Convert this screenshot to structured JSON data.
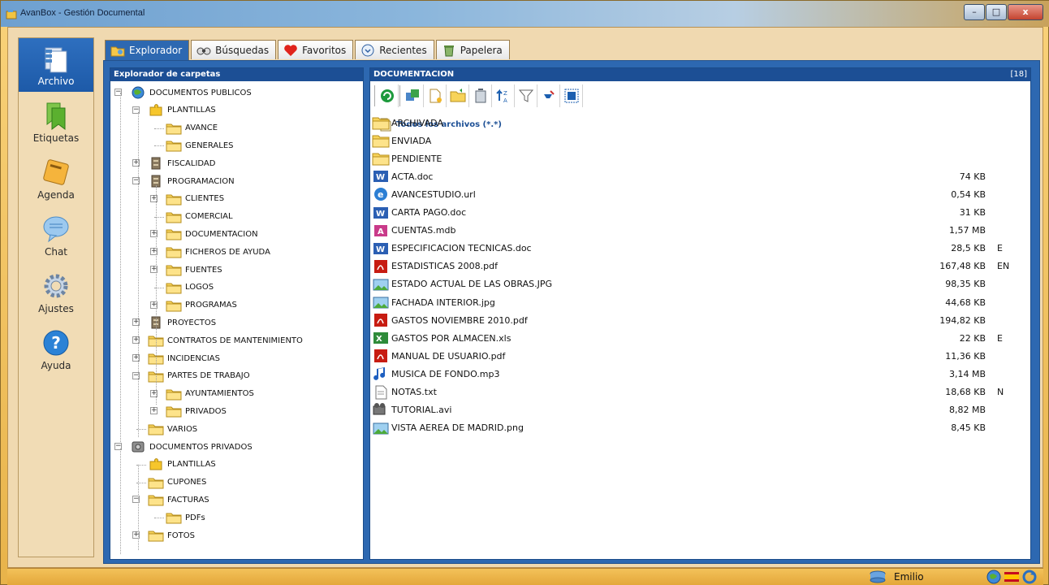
{
  "window": {
    "title": "AvanBox - Gestión Documental",
    "min": "–",
    "max": "□",
    "close": "x"
  },
  "nav": [
    {
      "label": "Archivo",
      "icon": "archive-icon"
    },
    {
      "label": "Etiquetas",
      "icon": "tag-icon"
    },
    {
      "label": "Agenda",
      "icon": "agenda-book-icon"
    },
    {
      "label": "Chat",
      "icon": "chat-bubble-icon"
    },
    {
      "label": "Ajustes",
      "icon": "gear-icon"
    },
    {
      "label": "Ayuda",
      "icon": "help-icon"
    }
  ],
  "tabs": [
    {
      "label": "Explorador",
      "icon": "explorer-folder-icon"
    },
    {
      "label": "Búsquedas",
      "icon": "binoculars-icon"
    },
    {
      "label": "Favoritos",
      "icon": "heart-icon"
    },
    {
      "label": "Recientes",
      "icon": "recent-clock-icon"
    },
    {
      "label": "Papelera",
      "icon": "trash-icon"
    }
  ],
  "tree_panel": {
    "title": "Explorador de carpetas"
  },
  "tree": [
    {
      "label": "DOCUMENTOS PUBLICOS",
      "level": 0,
      "exp": "−",
      "icon": "globe"
    },
    {
      "label": "PLANTILLAS",
      "level": 1,
      "exp": "−",
      "icon": "puzzle"
    },
    {
      "label": "AVANCE",
      "level": 2,
      "exp": "",
      "icon": "folder"
    },
    {
      "label": "GENERALES",
      "level": 2,
      "exp": "",
      "icon": "folder"
    },
    {
      "label": "FISCALIDAD",
      "level": 1,
      "exp": "+",
      "icon": "cabinet"
    },
    {
      "label": "PROGRAMACION",
      "level": 1,
      "exp": "−",
      "icon": "cabinet"
    },
    {
      "label": "CLIENTES",
      "level": 2,
      "exp": "+",
      "icon": "folder"
    },
    {
      "label": "COMERCIAL",
      "level": 2,
      "exp": "",
      "icon": "folder"
    },
    {
      "label": "DOCUMENTACION",
      "level": 2,
      "exp": "+",
      "icon": "folder"
    },
    {
      "label": "FICHEROS DE AYUDA",
      "level": 2,
      "exp": "+",
      "icon": "folder"
    },
    {
      "label": "FUENTES",
      "level": 2,
      "exp": "+",
      "icon": "folder"
    },
    {
      "label": "LOGOS",
      "level": 2,
      "exp": "",
      "icon": "folder"
    },
    {
      "label": "PROGRAMAS",
      "level": 2,
      "exp": "+",
      "icon": "folder"
    },
    {
      "label": "PROYECTOS",
      "level": 1,
      "exp": "+",
      "icon": "cabinet"
    },
    {
      "label": "CONTRATOS DE MANTENIMIENTO",
      "level": 1,
      "exp": "+",
      "icon": "folder"
    },
    {
      "label": "INCIDENCIAS",
      "level": 1,
      "exp": "+",
      "icon": "folder"
    },
    {
      "label": "PARTES DE TRABAJO",
      "level": 1,
      "exp": "−",
      "icon": "folder"
    },
    {
      "label": "AYUNTAMIENTOS",
      "level": 2,
      "exp": "+",
      "icon": "folder"
    },
    {
      "label": "PRIVADOS",
      "level": 2,
      "exp": "+",
      "icon": "folder"
    },
    {
      "label": "VARIOS",
      "level": 1,
      "exp": "",
      "icon": "folder"
    },
    {
      "label": "DOCUMENTOS PRIVADOS",
      "level": 0,
      "exp": "−",
      "icon": "safe"
    },
    {
      "label": "PLANTILLAS",
      "level": 1,
      "exp": "",
      "icon": "puzzle"
    },
    {
      "label": "CUPONES",
      "level": 1,
      "exp": "",
      "icon": "folder"
    },
    {
      "label": "FACTURAS",
      "level": 1,
      "exp": "−",
      "icon": "folder"
    },
    {
      "label": "PDFs",
      "level": 2,
      "exp": "",
      "icon": "folder"
    },
    {
      "label": "FOTOS",
      "level": 1,
      "exp": "+",
      "icon": "folder"
    }
  ],
  "files_panel": {
    "title": "DOCUMENTACION",
    "count": "[18]"
  },
  "toolbar": [
    "refresh-icon",
    "move-icon",
    "new-file-icon",
    "new-folder-icon",
    "delete-icon",
    "sort-az-icon",
    "filter-icon",
    "clear-filter-icon",
    "view-icon"
  ],
  "all_files": "Todos los archivos (*.*)",
  "files": [
    {
      "name": "ARCHIVADA",
      "size": "",
      "flag": "",
      "type": "folder"
    },
    {
      "name": "ENVIADA",
      "size": "",
      "flag": "",
      "type": "folder"
    },
    {
      "name": "PENDIENTE",
      "size": "",
      "flag": "",
      "type": "folder"
    },
    {
      "name": "ACTA.doc",
      "size": "74 KB",
      "flag": "",
      "type": "word"
    },
    {
      "name": "AVANCESTUDIO.url",
      "size": "0,54 KB",
      "flag": "",
      "type": "ie"
    },
    {
      "name": "CARTA PAGO.doc",
      "size": "31 KB",
      "flag": "",
      "type": "word"
    },
    {
      "name": "CUENTAS.mdb",
      "size": "1,57 MB",
      "flag": "",
      "type": "access"
    },
    {
      "name": "ESPECIFICACION TECNICAS.doc",
      "size": "28,5 KB",
      "flag": "E",
      "type": "word"
    },
    {
      "name": "ESTADISTICAS 2008.pdf",
      "size": "167,48 KB",
      "flag": "EN",
      "type": "pdf"
    },
    {
      "name": "ESTADO ACTUAL DE LAS OBRAS.JPG",
      "size": "98,35 KB",
      "flag": "",
      "type": "image"
    },
    {
      "name": "FACHADA INTERIOR.jpg",
      "size": "44,68 KB",
      "flag": "",
      "type": "image"
    },
    {
      "name": "GASTOS NOVIEMBRE 2010.pdf",
      "size": "194,82 KB",
      "flag": "",
      "type": "pdf"
    },
    {
      "name": "GASTOS POR ALMACEN.xls",
      "size": "22 KB",
      "flag": "E",
      "type": "excel"
    },
    {
      "name": "MANUAL DE USUARIO.pdf",
      "size": "11,36 KB",
      "flag": "",
      "type": "pdf"
    },
    {
      "name": "MUSICA DE FONDO.mp3",
      "size": "3,14 MB",
      "flag": "",
      "type": "music"
    },
    {
      "name": "NOTAS.txt",
      "size": "18,68 KB",
      "flag": "N",
      "type": "text"
    },
    {
      "name": "TUTORIAL.avi",
      "size": "8,82 MB",
      "flag": "",
      "type": "video"
    },
    {
      "name": "VISTA AEREA DE MADRID.png",
      "size": "8,45 KB",
      "flag": "",
      "type": "image"
    }
  ],
  "status": {
    "user": "Emilio"
  },
  "colors": {
    "accent": "#2d68b1",
    "panel_head": "#1c4f95",
    "frame": "#f0d9b0"
  }
}
